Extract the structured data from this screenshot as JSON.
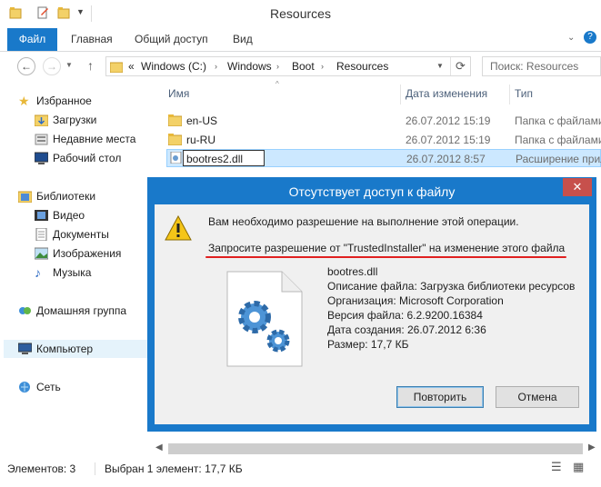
{
  "window": {
    "title": "Resources"
  },
  "ribbon": {
    "tabs": [
      "Файл",
      "Главная",
      "Общий доступ",
      "Вид"
    ]
  },
  "address": {
    "overflow": "«",
    "path": [
      "Windows (C:)",
      "Windows",
      "Boot",
      "Resources"
    ],
    "search_placeholder": "Поиск: Resources"
  },
  "nav": {
    "favorites": "Избранное",
    "downloads": "Загрузки",
    "recent": "Недавние места",
    "desktop": "Рабочий стол",
    "libraries": "Библиотеки",
    "video": "Видео",
    "documents": "Документы",
    "images": "Изображения",
    "music": "Музыка",
    "homegroup": "Домашняя группа",
    "computer": "Компьютер",
    "network": "Сеть"
  },
  "columns": {
    "name": "Имя",
    "date": "Дата изменения",
    "type": "Тип"
  },
  "files": [
    {
      "name": "en-US",
      "date": "26.07.2012 15:19",
      "type": "Папка с файлами"
    },
    {
      "name": "ru-RU",
      "date": "26.07.2012 15:19",
      "type": "Папка с файлами"
    },
    {
      "name": "bootres2.dll",
      "date": "26.07.2012 8:57",
      "type": "Расширение прил"
    }
  ],
  "dialog": {
    "title": "Отсутствует доступ к файлу",
    "close": "✕",
    "message": "Вам необходимо разрешение на выполнение этой операции.",
    "request": "Запросите разрешение от \"TrustedInstaller\" на изменение этого файла",
    "file_name": "bootres.dll",
    "description": "Описание файла: Загрузка библиотеки ресурсов",
    "organization": "Организация: Microsoft Corporation",
    "version": "Версия файла: 6.2.9200.16384",
    "created": "Дата создания: 26.07.2012 6:36",
    "size": "Размер: 17,7 КБ",
    "retry": "Повторить",
    "cancel": "Отмена"
  },
  "status": {
    "items": "Элементов: 3",
    "selected": "Выбран 1 элемент: 17,7 КБ"
  },
  "colors": {
    "accent": "#1979ca",
    "close_red": "#c7504c",
    "selection": "#cce8ff",
    "underline": "#e02020"
  }
}
